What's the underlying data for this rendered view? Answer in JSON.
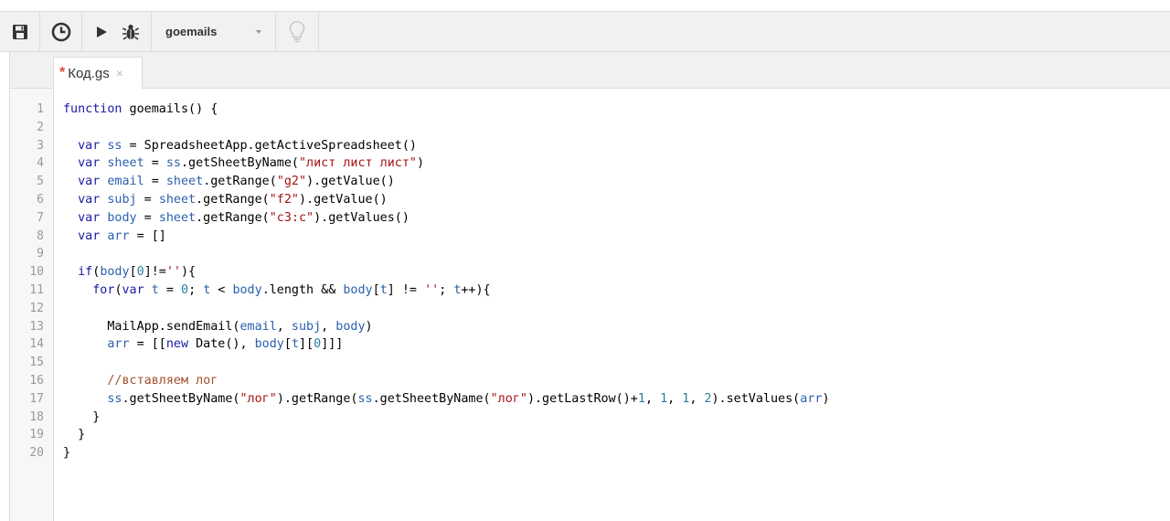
{
  "toolbar": {
    "save_icon": "floppy-disk-icon",
    "triggers_icon": "clock-icon",
    "run_icon": "play-icon",
    "debug_icon": "bug-icon",
    "function_select_value": "goemails",
    "hint_icon": "lightbulb-icon"
  },
  "tabs": [
    {
      "label": "Код.gs",
      "modified": true,
      "modified_marker": "*",
      "close_glyph": "×"
    }
  ],
  "editor": {
    "line_numbers": [
      "1",
      "2",
      "3",
      "4",
      "5",
      "6",
      "7",
      "8",
      "9",
      "10",
      "11",
      "12",
      "13",
      "14",
      "15",
      "16",
      "17",
      "18",
      "19",
      "20"
    ],
    "lines": [
      "function goemails() {",
      "",
      "  var ss = SpreadsheetApp.getActiveSpreadsheet()",
      "  var sheet = ss.getSheetByName(\"лист лист лист\")",
      "  var email = sheet.getRange(\"g2\").getValue()",
      "  var subj = sheet.getRange(\"f2\").getValue()",
      "  var body = sheet.getRange(\"c3:c\").getValues()",
      "  var arr = []",
      "",
      "  if(body[0]!=''){",
      "    for(var t = 0; t < body.length && body[t] != ''; t++){",
      "",
      "      MailApp.sendEmail(email, subj, body)",
      "      arr = [[new Date(), body[t][0]]]",
      "",
      "      //вставляем лог",
      "      ss.getSheetByName(\"лог\").getRange(ss.getSheetByName(\"лог\").getLastRow()+1, 1, 1, 2).setValues(arr)",
      "    }",
      "  }",
      "}"
    ]
  },
  "colors": {
    "keyword": "#1a1aa6",
    "variable": "#2b5fad",
    "string": "#a31515",
    "number": "#2a7f9a",
    "comment": "#a0522d",
    "modified_marker": "#dd4b39"
  }
}
